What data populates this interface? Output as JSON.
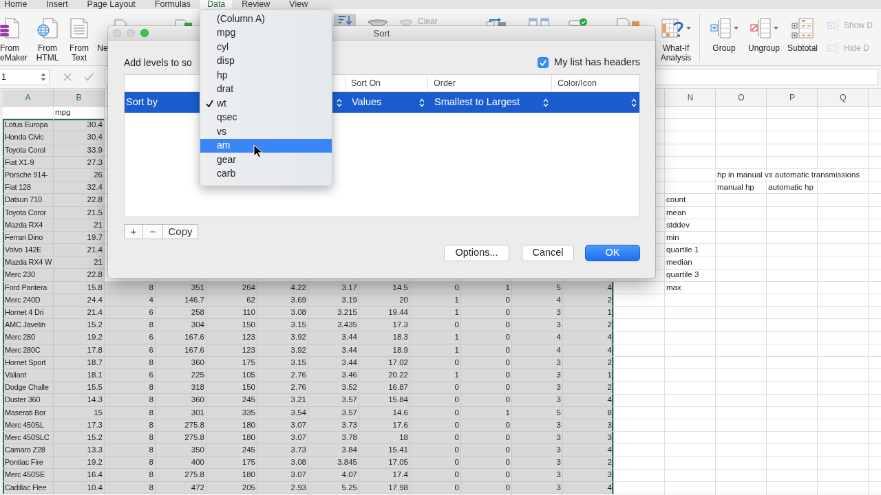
{
  "ribbon": {
    "tabs": [
      {
        "label": "Home",
        "selected": false
      },
      {
        "label": "Insert",
        "selected": false
      },
      {
        "label": "Page Layout",
        "selected": false
      },
      {
        "label": "Formulas",
        "selected": false
      },
      {
        "label": "Data",
        "selected": true
      },
      {
        "label": "Review",
        "selected": false
      },
      {
        "label": "View",
        "selected": false
      }
    ],
    "left_commands": [
      {
        "label": "From\neMaker"
      },
      {
        "label": "From\nHTML"
      },
      {
        "label": "From\nText"
      },
      {
        "label": "Ne"
      }
    ],
    "clear_command": {
      "label": "Clear",
      "disabled": true
    },
    "right_commands": [
      {
        "label": "What-If\nAnalysis",
        "caret": true
      },
      {
        "label": "Group",
        "caret": true
      },
      {
        "label": "Ungroup",
        "caret": true
      },
      {
        "label": "Subtotal",
        "caret": false
      }
    ],
    "outline_commands": [
      {
        "label": "Show D",
        "disabled": true
      },
      {
        "label": "Hide D",
        "disabled": true
      }
    ]
  },
  "formula_bar": {
    "name_box": "1"
  },
  "sheet": {
    "columns": [
      {
        "label": "A",
        "highlighted": true
      },
      {
        "label": "B",
        "highlighted": true
      },
      {
        "label": "N",
        "highlighted": false
      },
      {
        "label": "O",
        "highlighted": false
      },
      {
        "label": "P",
        "highlighted": false
      },
      {
        "label": "Q",
        "highlighted": false
      }
    ],
    "field_names": [
      "mpg"
    ],
    "records": [
      {
        "name": "Lotus Europa",
        "mpg": "30.4",
        "selected": true
      },
      {
        "name": "Honda Civic",
        "mpg": "30.4",
        "selected": true
      },
      {
        "name": "Toyota Corol",
        "mpg": "33.9",
        "selected": true
      },
      {
        "name": "Fiat X1-9",
        "mpg": "27.3",
        "selected": true
      },
      {
        "name": "Porsche 914-",
        "mpg": "26",
        "selected": true
      },
      {
        "name": "Fiat 128",
        "mpg": "32.4",
        "selected": true
      },
      {
        "name": "Datsun 710",
        "mpg": "22.8",
        "selected": true
      },
      {
        "name": "Toyota Coror",
        "mpg": "21.5",
        "selected": true
      },
      {
        "name": "Mazda RX4",
        "mpg": "21",
        "selected": true
      },
      {
        "name": "Ferrari Dino",
        "mpg": "19.7",
        "selected": true
      },
      {
        "name": "Volvo 142E",
        "mpg": "21.4",
        "selected": true
      },
      {
        "name": "Mazda RX4 W",
        "mpg": "21",
        "selected": true
      },
      {
        "name": "Merc 230",
        "mpg": "22.8",
        "selected": true
      },
      {
        "name": "Ford Pantera",
        "mpg": "15.8",
        "values": [
          "8",
          "351",
          "264",
          "4.22",
          "3.17",
          "14.5",
          "0",
          "1",
          "5",
          "4"
        ],
        "selected": true
      },
      {
        "name": "Merc 240D",
        "mpg": "24.4",
        "values": [
          "4",
          "146.7",
          "62",
          "3.69",
          "3.19",
          "20",
          "1",
          "0",
          "4",
          "2"
        ],
        "selected": true
      },
      {
        "name": "Hornet 4 Dri",
        "mpg": "21.4",
        "values": [
          "6",
          "258",
          "110",
          "3.08",
          "3.215",
          "19.44",
          "1",
          "0",
          "3",
          "1"
        ],
        "selected": true
      },
      {
        "name": "AMC Javelin",
        "mpg": "15.2",
        "values": [
          "8",
          "304",
          "150",
          "3.15",
          "3.435",
          "17.3",
          "0",
          "0",
          "3",
          "2"
        ],
        "selected": true
      },
      {
        "name": "Merc 280",
        "mpg": "19.2",
        "values": [
          "6",
          "167.6",
          "123",
          "3.92",
          "3.44",
          "18.3",
          "1",
          "0",
          "4",
          "4"
        ],
        "selected": true
      },
      {
        "name": "Merc 280C",
        "mpg": "17.8",
        "values": [
          "6",
          "167.6",
          "123",
          "3.92",
          "3.44",
          "18.9",
          "1",
          "0",
          "4",
          "4"
        ],
        "selected": true
      },
      {
        "name": "Hornet Sport",
        "mpg": "18.7",
        "values": [
          "8",
          "360",
          "175",
          "3.15",
          "3.44",
          "17.02",
          "0",
          "0",
          "3",
          "2"
        ],
        "selected": true
      },
      {
        "name": "Valiant",
        "mpg": "18.1",
        "values": [
          "6",
          "225",
          "105",
          "2.76",
          "3.46",
          "20.22",
          "1",
          "0",
          "3",
          "1"
        ],
        "selected": true
      },
      {
        "name": "Dodge Challe",
        "mpg": "15.5",
        "values": [
          "8",
          "318",
          "150",
          "2.76",
          "3.52",
          "16.87",
          "0",
          "0",
          "3",
          "2"
        ],
        "selected": true
      },
      {
        "name": "Duster 360",
        "mpg": "14.3",
        "values": [
          "8",
          "360",
          "245",
          "3.21",
          "3.57",
          "15.84",
          "0",
          "0",
          "3",
          "4"
        ],
        "selected": true
      },
      {
        "name": "Maserati Bor",
        "mpg": "15",
        "values": [
          "8",
          "301",
          "335",
          "3.54",
          "3.57",
          "14.6",
          "0",
          "1",
          "5",
          "8"
        ],
        "selected": true
      },
      {
        "name": "Merc 450SL",
        "mpg": "17.3",
        "values": [
          "8",
          "275.8",
          "180",
          "3.07",
          "3.73",
          "17.6",
          "0",
          "0",
          "3",
          "3"
        ],
        "selected": true
      },
      {
        "name": "Merc 450SLC",
        "mpg": "15.2",
        "values": [
          "8",
          "275.8",
          "180",
          "3.07",
          "3.78",
          "18",
          "0",
          "0",
          "3",
          "3"
        ],
        "selected": true
      },
      {
        "name": "Camaro Z28",
        "mpg": "13.3",
        "values": [
          "8",
          "350",
          "245",
          "3.73",
          "3.84",
          "15.41",
          "0",
          "0",
          "3",
          "4"
        ],
        "selected": true
      },
      {
        "name": "Pontiac Fire",
        "mpg": "19.2",
        "values": [
          "8",
          "400",
          "175",
          "3.08",
          "3.845",
          "17.05",
          "0",
          "0",
          "3",
          "2"
        ],
        "selected": true
      },
      {
        "name": "Merc 450SE",
        "mpg": "16.4",
        "values": [
          "8",
          "275.8",
          "180",
          "3.07",
          "4.07",
          "17.4",
          "0",
          "0",
          "3",
          "3"
        ],
        "selected": true
      },
      {
        "name": "Cadillac Flee",
        "mpg": "10.4",
        "values": [
          "8",
          "472",
          "205",
          "2.93",
          "5.25",
          "17.98",
          "0",
          "0",
          "3",
          "4"
        ],
        "selected": true
      }
    ],
    "stats": {
      "title": "hp in manual vs automatic transmissions",
      "columns": [
        "manual hp",
        "automatic hp"
      ],
      "rows": [
        "count",
        "mean",
        "stddev",
        "min",
        "quartile 1",
        "median",
        "quartile 3",
        "max"
      ]
    }
  },
  "sort_dialog": {
    "title": "Sort",
    "intro": "Add levels to so",
    "has_headers": {
      "label": "My list has headers",
      "checked": true
    },
    "columns": [
      "Sort On",
      "Order",
      "Color/Icon"
    ],
    "levels": [
      {
        "label": "Sort by",
        "selected": true,
        "sort_on": "Values",
        "order": "Smallest to Largest"
      }
    ],
    "level_buttons": [
      "+",
      "−",
      "Copy"
    ],
    "buttons": [
      {
        "label": "Options...",
        "default": false
      },
      {
        "label": "Cancel",
        "default": false
      },
      {
        "label": "OK",
        "default": true
      }
    ]
  },
  "column_menu": {
    "items": [
      {
        "label": "(Column A)",
        "checked": false,
        "selected": false
      },
      {
        "label": "mpg",
        "checked": false,
        "selected": false
      },
      {
        "label": "cyl",
        "checked": false,
        "selected": false
      },
      {
        "label": "disp",
        "checked": false,
        "selected": false
      },
      {
        "label": "hp",
        "checked": false,
        "selected": false
      },
      {
        "label": "drat",
        "checked": false,
        "selected": false
      },
      {
        "label": "wt",
        "checked": true,
        "selected": false
      },
      {
        "label": "qsec",
        "checked": false,
        "selected": false
      },
      {
        "label": "vs",
        "checked": false,
        "selected": false
      },
      {
        "label": "am",
        "checked": false,
        "selected": true
      },
      {
        "label": "gear",
        "checked": false,
        "selected": false
      },
      {
        "label": "carb",
        "checked": false,
        "selected": false
      }
    ]
  }
}
